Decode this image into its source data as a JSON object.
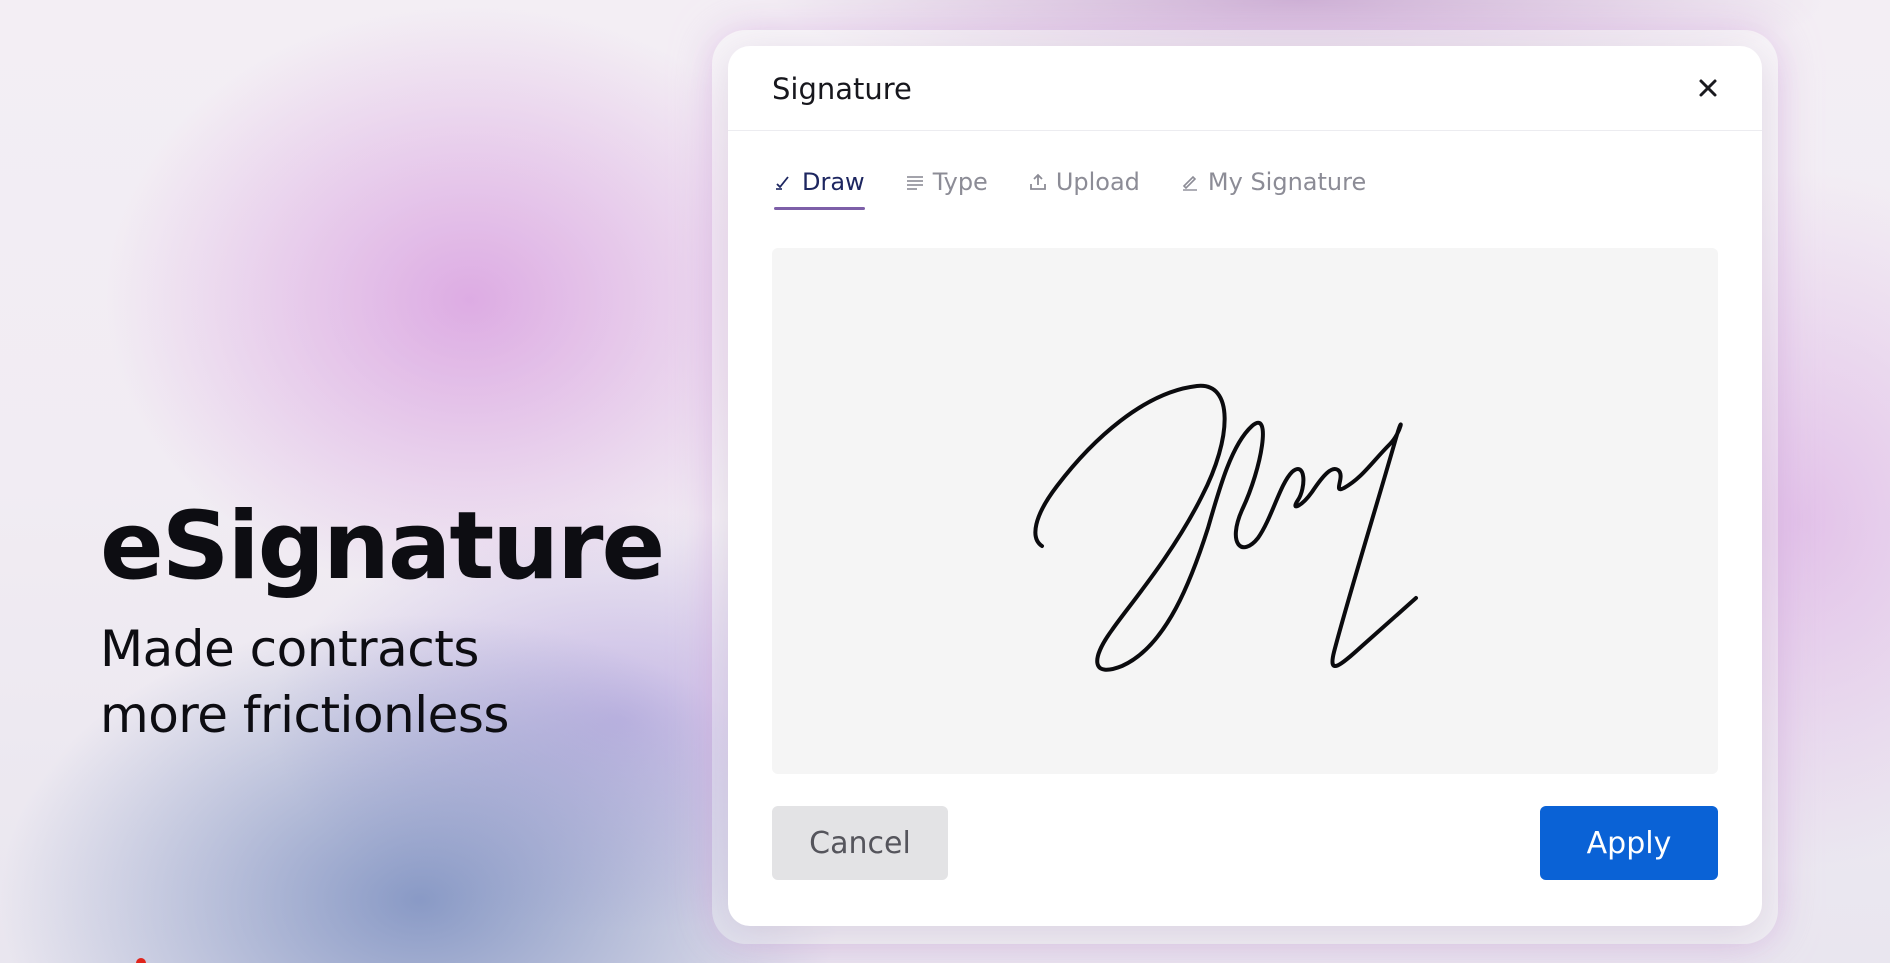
{
  "hero": {
    "title": "eSignature",
    "subtitle_line1": "Made contracts",
    "subtitle_line2": "more frictionless"
  },
  "modal": {
    "title": "Signature",
    "close_icon": "close-icon",
    "tabs": [
      {
        "label": "Draw",
        "icon": "draw-icon",
        "active": true
      },
      {
        "label": "Type",
        "icon": "text-lines-icon",
        "active": false
      },
      {
        "label": "Upload",
        "icon": "upload-icon",
        "active": false
      },
      {
        "label": "My Signature",
        "icon": "pen-icon",
        "active": false
      }
    ],
    "cancel_label": "Cancel",
    "apply_label": "Apply"
  },
  "colors": {
    "accent": "#0a62d6",
    "tab_active_underline": "#7d5fa8",
    "tab_active_text": "#1d2660",
    "canvas_bg": "#f5f5f5"
  }
}
